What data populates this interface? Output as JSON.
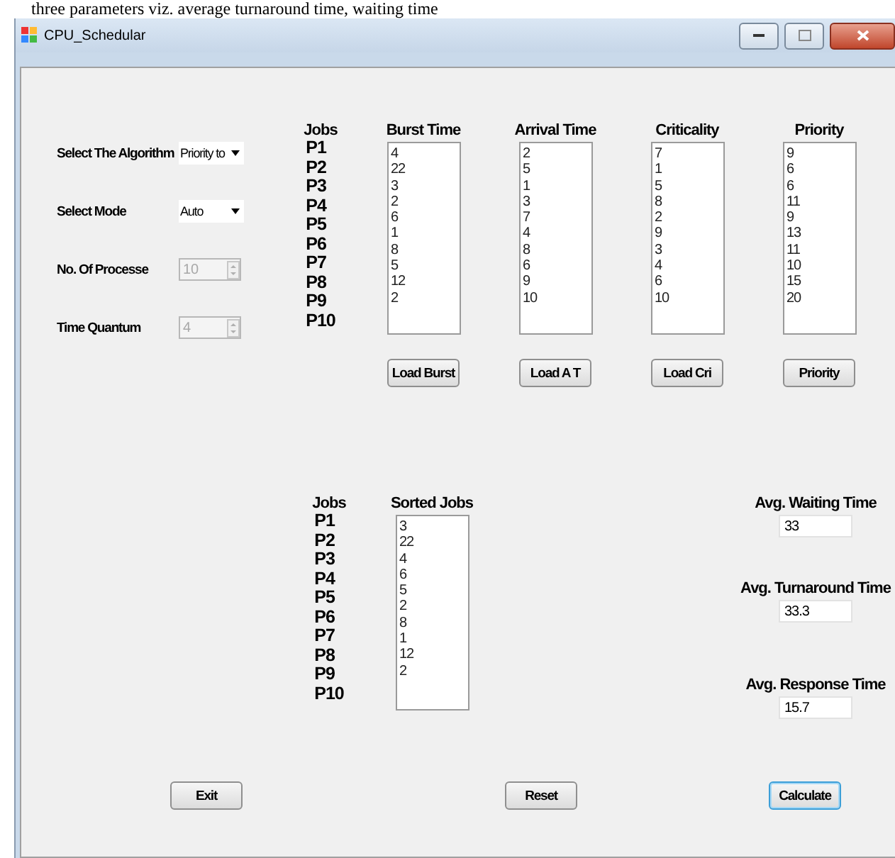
{
  "caption_line": "three parameters viz. average turnaround time, waiting time",
  "window": {
    "title": "CPU_Schedular"
  },
  "settings": [
    {
      "kind": "dropdown",
      "label": "Select The Algorithm",
      "value": "Priority to",
      "disabled": false
    },
    {
      "kind": "dropdown",
      "label": "Select Mode",
      "value": "Auto",
      "disabled": false
    },
    {
      "kind": "spinner",
      "label": "No. Of Processe",
      "value": "10",
      "disabled": true
    },
    {
      "kind": "spinner",
      "label": "Time Quantum",
      "value": "4",
      "disabled": true
    }
  ],
  "jobs_header": "Jobs",
  "jobs": [
    "P1",
    "P2",
    "P3",
    "P4",
    "P5",
    "P6",
    "P7",
    "P8",
    "P9",
    "P10"
  ],
  "input_lists": [
    {
      "heading": "Burst Time",
      "values": [
        "4",
        "22",
        "3",
        "2",
        "6",
        "1",
        "8",
        "5",
        "12",
        "2"
      ],
      "button": "Load Burst"
    },
    {
      "heading": "Arrival Time",
      "values": [
        "2",
        "5",
        "1",
        "3",
        "7",
        "4",
        "8",
        "6",
        "9",
        "10"
      ],
      "button": "Load A T"
    },
    {
      "heading": "Criticality",
      "values": [
        "7",
        "1",
        "5",
        "8",
        "2",
        "9",
        "3",
        "4",
        "6",
        "10"
      ],
      "button": "Load Cri"
    },
    {
      "heading": "Priority",
      "values": [
        "9",
        "6",
        "6",
        "11",
        "9",
        "13",
        "11",
        "10",
        "15",
        "20"
      ],
      "button": "Priority"
    }
  ],
  "sorted": {
    "jobs_header": "Jobs",
    "jobs": [
      "P1",
      "P2",
      "P3",
      "P4",
      "P5",
      "P6",
      "P7",
      "P8",
      "P9",
      "P10"
    ],
    "heading": "Sorted Jobs",
    "values": [
      "3",
      "22",
      "4",
      "6",
      "5",
      "2",
      "8",
      "1",
      "12",
      "2"
    ]
  },
  "averages": [
    {
      "label": "Avg. Waiting Time",
      "value": "33"
    },
    {
      "label": "Avg. Turnaround Time",
      "value": "33.3"
    },
    {
      "label": "Avg. Response Time",
      "value": "15.7"
    }
  ],
  "buttons": [
    {
      "label": "Exit",
      "focused": false
    },
    {
      "label": "Reset",
      "focused": false
    },
    {
      "label": "Calculate",
      "focused": true
    }
  ]
}
